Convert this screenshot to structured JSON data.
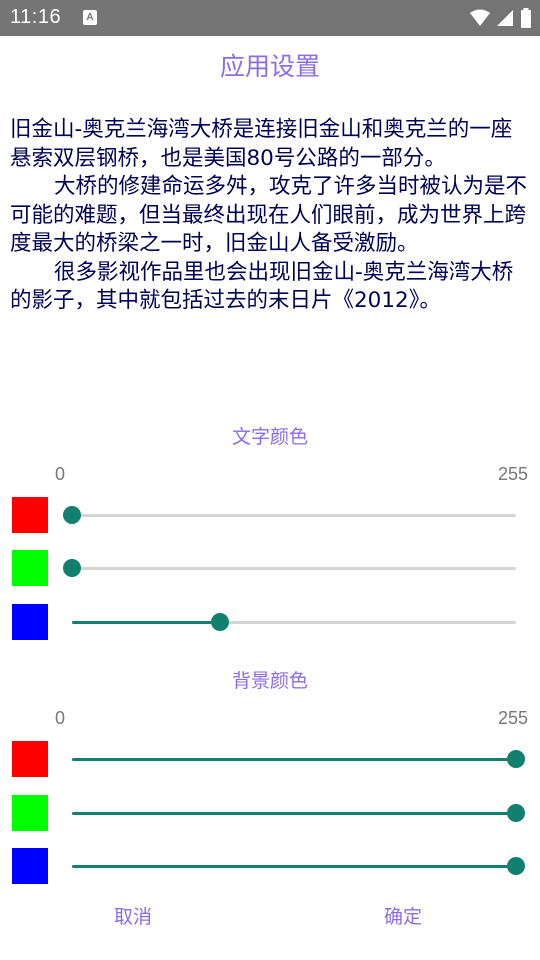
{
  "status_bar": {
    "time": "11:16",
    "notification_badge": "A",
    "icons": [
      "wifi-icon",
      "signal-icon",
      "battery-icon"
    ]
  },
  "title": "应用设置",
  "article": {
    "paragraphs": [
      "旧金山-奥克兰海湾大桥是连接旧金山和奥克兰的一座悬索双层钢桥，也是美国80号公路的一部分。",
      "大桥的修建命运多舛，攻克了许多当时被认为是不可能的难题，但当最终出现在人们眼前，成为世界上跨度最大的桥梁之一时，旧金山人备受激励。",
      "很多影视作品里也会出现旧金山-奥克兰海湾大桥的影子，其中就包括过去的末日片《2012》。"
    ]
  },
  "text_color": {
    "heading": "文字颜色",
    "min_label": "0",
    "max_label": "255",
    "sliders": [
      {
        "channel": "red",
        "swatch_color": "#ff0000",
        "value": 0
      },
      {
        "channel": "green",
        "swatch_color": "#00ff00",
        "value": 0
      },
      {
        "channel": "blue",
        "swatch_color": "#0000ff",
        "value": 85
      }
    ]
  },
  "background_color": {
    "heading": "背景颜色",
    "min_label": "0",
    "max_label": "255",
    "sliders": [
      {
        "channel": "red",
        "swatch_color": "#ff0000",
        "value": 255
      },
      {
        "channel": "green",
        "swatch_color": "#00ff00",
        "value": 255
      },
      {
        "channel": "blue",
        "swatch_color": "#0000ff",
        "value": 255
      }
    ]
  },
  "buttons": {
    "cancel": "取消",
    "confirm": "确定"
  },
  "colors": {
    "accent": "#8b6ce6",
    "slider": "#11806f",
    "track": "#d5d5d5",
    "article_text": "#000055",
    "status_bar": "#757575"
  }
}
